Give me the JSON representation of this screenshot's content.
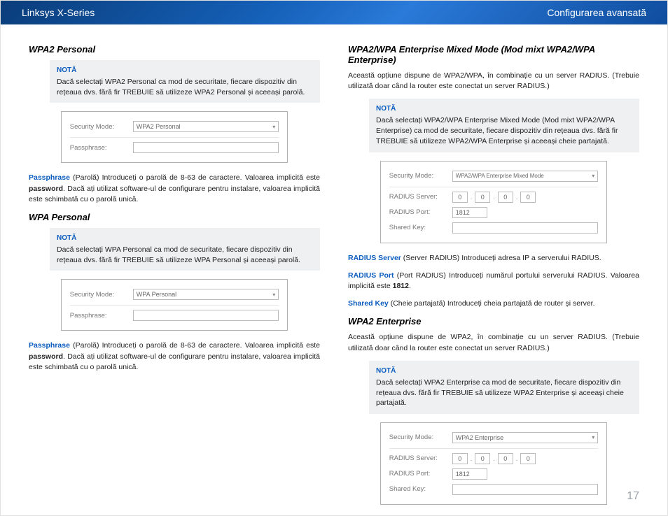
{
  "header": {
    "left": "Linksys X-Series",
    "right": "Configurarea avansată"
  },
  "left_col": {
    "wpa2_personal": {
      "title": "WPA2 Personal",
      "note_label": "NOTĂ",
      "note_text": "Dacă selectați WPA2 Personal ca mod de securitate, fiecare dispozitiv din rețeaua dvs. fără fir TREBUIE să utilizeze WPA2 Personal și aceeași parolă.",
      "panel": {
        "security_mode_label": "Security Mode:",
        "security_mode_value": "WPA2 Personal",
        "passphrase_label": "Passphrase:",
        "passphrase_value": ""
      },
      "desc_kw": "Passphrase",
      "desc_text_1": " (Parolă) Introduceți o parolă de 8-63 de caractere. Valoarea implicită este ",
      "desc_bold": "password",
      "desc_text_2": ". Dacă ați utilizat software-ul de configurare pentru instalare, valoarea implicită este schimbată cu o parolă unică."
    },
    "wpa_personal": {
      "title": "WPA Personal",
      "note_label": "NOTĂ",
      "note_text": "Dacă selectați WPA Personal ca mod de securitate, fiecare dispozitiv din rețeaua dvs. fără fir TREBUIE să utilizeze WPA Personal și aceeași parolă.",
      "panel": {
        "security_mode_label": "Security Mode:",
        "security_mode_value": "WPA Personal",
        "passphrase_label": "Passphrase:",
        "passphrase_value": ""
      },
      "desc_kw": "Passphrase",
      "desc_text_1": " (Parolă) Introduceți o parolă de 8-63 de caractere. Valoarea implicită este ",
      "desc_bold": "password",
      "desc_text_2": ". Dacă ați utilizat software-ul de configurare pentru instalare, valoarea implicită este schimbată cu o parolă unică."
    }
  },
  "right_col": {
    "mixed": {
      "title": "WPA2/WPA Enterprise Mixed Mode (Mod mixt WPA2/WPA Enterprise)",
      "intro": "Această opțiune dispune de WPA2/WPA, în combinație cu un server RADIUS. (Trebuie utilizată doar când la router este conectat un server RADIUS.)",
      "note_label": "NOTĂ",
      "note_text": "Dacă selectați WPA2/WPA Enterprise Mixed Mode (Mod mixt WPA2/WPA Enterprise) ca mod de securitate, fiecare dispozitiv din rețeaua dvs. fără fir TREBUIE să utilizeze WPA2/WPA Enterprise și aceeași cheie partajată.",
      "panel": {
        "security_mode_label": "Security Mode:",
        "security_mode_value": "WPA2/WPA Enterprise Mixed Mode",
        "radius_server_label": "RADIUS Server:",
        "radius_ip": [
          "0",
          "0",
          "0",
          "0"
        ],
        "radius_port_label": "RADIUS Port:",
        "radius_port_value": "1812",
        "shared_key_label": "Shared Key:",
        "shared_key_value": ""
      },
      "fields": {
        "radius_server_kw": "RADIUS Server",
        "radius_server_txt": " (Server RADIUS) Introduceți adresa IP a serverului RADIUS.",
        "radius_port_kw": "RADIUS Port",
        "radius_port_txt_1": " (Port RADIUS) Introduceți numărul portului serverului RADIUS. Valoarea implicită este ",
        "radius_port_bold": "1812",
        "radius_port_txt_2": ".",
        "shared_key_kw": "Shared Key",
        "shared_key_txt": " (Cheie partajată) Introduceți cheia partajată de router și server."
      }
    },
    "wpa2_ent": {
      "title": "WPA2 Enterprise",
      "intro": "Această opțiune dispune de WPA2, în combinație cu un server RADIUS. (Trebuie utilizată doar când la router este conectat un server RADIUS.)",
      "note_label": "NOTĂ",
      "note_text": "Dacă selectați WPA2 Enterprise ca mod de securitate, fiecare dispozitiv din rețeaua dvs. fără fir TREBUIE să utilizeze WPA2 Enterprise și aceeași cheie partajată.",
      "panel": {
        "security_mode_label": "Security Mode:",
        "security_mode_value": "WPA2 Enterprise",
        "radius_server_label": "RADIUS Server:",
        "radius_ip": [
          "0",
          "0",
          "0",
          "0"
        ],
        "radius_port_label": "RADIUS Port:",
        "radius_port_value": "1812",
        "shared_key_label": "Shared Key:",
        "shared_key_value": ""
      }
    }
  },
  "page_number": "17"
}
